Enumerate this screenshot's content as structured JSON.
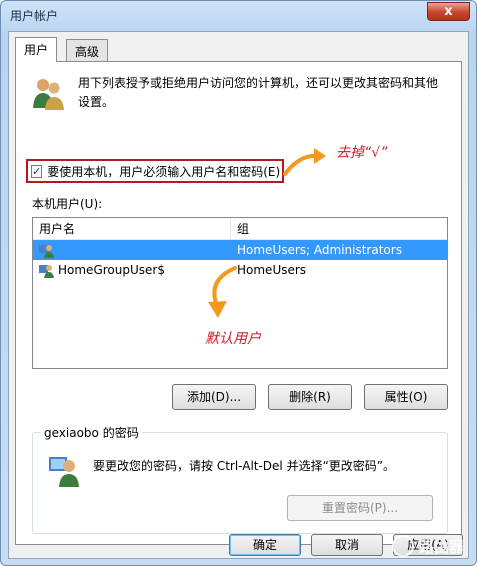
{
  "window": {
    "title": "用户帐户",
    "close_glyph": "x"
  },
  "tabs": [
    {
      "label": "用户"
    },
    {
      "label": "高级"
    }
  ],
  "description": "用下列表授予或拒绝用户访问您的计算机，还可以更改其密码和其他设置。",
  "require_login": {
    "checked": true,
    "label": "要使用本机，用户必须输入用户名和密码(E)"
  },
  "annotations": {
    "remove_check": "去掉“√”",
    "default_user": "默认用户"
  },
  "local_users": {
    "label": "本机用户(U):",
    "columns": [
      "用户名",
      "组"
    ],
    "rows": [
      {
        "name": "",
        "group": "HomeUsers; Administrators",
        "selected": true
      },
      {
        "name": "HomeGroupUser$",
        "group": "HomeUsers",
        "selected": false
      }
    ]
  },
  "list_buttons": {
    "add": "添加(D)...",
    "delete": "删除(R)",
    "properties": "属性(O)"
  },
  "password_group": {
    "title": "gexiaobo 的密码",
    "text": "要更改您的密码，请按 Ctrl-Alt-Del 并选择“更改密码”。",
    "reset_button": "重置密码(P)..."
  },
  "dialog_buttons": {
    "ok": "确定",
    "cancel": "取消",
    "apply": "应用(A)"
  },
  "watermark": "路由器",
  "colors": {
    "selection": "#3399ff",
    "annotation": "#c8202a",
    "arrow": "#f39a1e"
  }
}
